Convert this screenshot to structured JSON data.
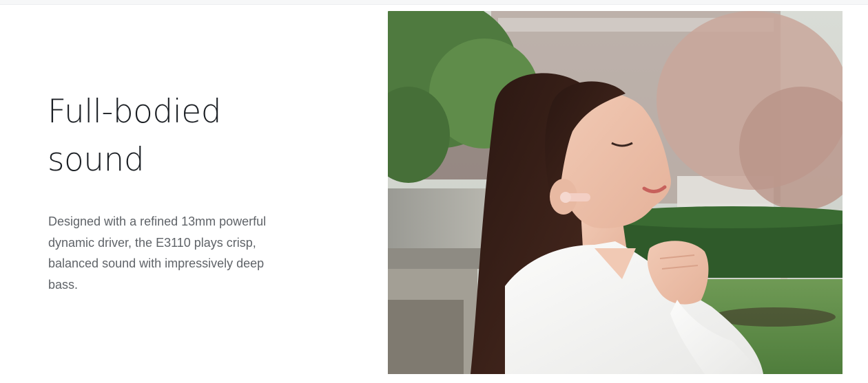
{
  "feature": {
    "headline_line1": "Full-bodied",
    "headline_line2": "sound",
    "description": "Designed with a refined 13mm powerful dynamic driver, the E3110 plays crisp, balanced sound with impressively deep bass."
  },
  "colors": {
    "headline": "#1b1f24",
    "body_text": "#5f6368",
    "background": "#ffffff",
    "earbud": "#f3cfc4"
  }
}
